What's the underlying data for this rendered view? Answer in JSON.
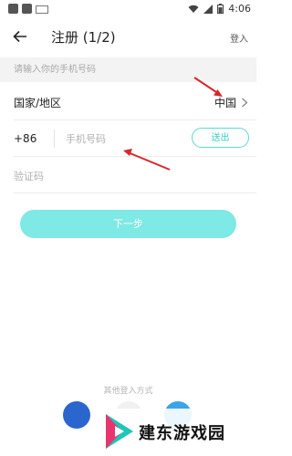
{
  "status_bar": {
    "time": "4:06"
  },
  "header": {
    "title": "注册 (1/2)",
    "login_label": "登入"
  },
  "hint": "请输入你的手机号码",
  "region": {
    "label": "国家/地区",
    "value": "中国"
  },
  "phone": {
    "country_code": "+86",
    "placeholder": "手机号码",
    "send_label": "送出"
  },
  "code": {
    "placeholder": "验证码"
  },
  "next_label": "下一步",
  "other_login_label": "其他登入方式",
  "watermark": {
    "text": "建东游戏园"
  },
  "colors": {
    "accent": "#59d9d3",
    "button_fill": "#7ee9e5",
    "annotation_arrow": "#d9262c"
  },
  "icons": [
    "back-arrow-icon",
    "chevron-right-icon",
    "wifi-icon",
    "signal-icon",
    "battery-icon",
    "facebook-icon",
    "google-icon",
    "twitter-icon"
  ]
}
